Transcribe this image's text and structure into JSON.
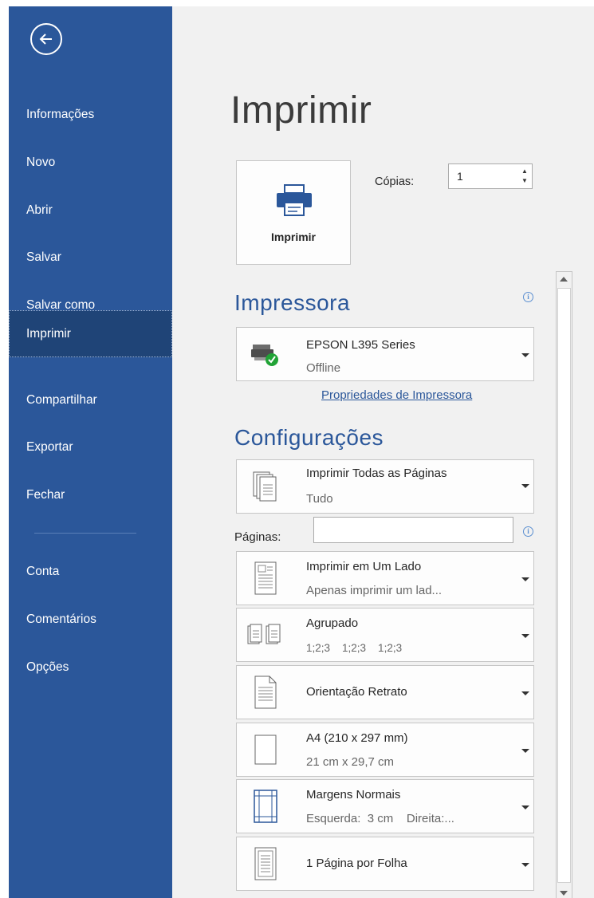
{
  "sidebar": {
    "items": [
      {
        "label": "Informações",
        "name": "sidebar-item-informacoes"
      },
      {
        "label": "Novo",
        "name": "sidebar-item-novo"
      },
      {
        "label": "Abrir",
        "name": "sidebar-item-abrir"
      },
      {
        "label": "Salvar",
        "name": "sidebar-item-salvar"
      },
      {
        "label": "Salvar como",
        "name": "sidebar-item-salvar-como"
      },
      {
        "label": "Imprimir",
        "name": "sidebar-item-imprimir",
        "active": true
      },
      {
        "label": "Compartilhar",
        "name": "sidebar-item-compartilhar"
      },
      {
        "label": "Exportar",
        "name": "sidebar-item-exportar"
      },
      {
        "label": "Fechar",
        "name": "sidebar-item-fechar"
      }
    ],
    "bottom_items": [
      {
        "label": "Conta",
        "name": "sidebar-item-conta"
      },
      {
        "label": "Comentários",
        "name": "sidebar-item-comentarios"
      },
      {
        "label": "Opções",
        "name": "sidebar-item-opcoes"
      }
    ]
  },
  "main": {
    "title": "Imprimir",
    "print_button_label": "Imprimir",
    "copies_label": "Cópias:",
    "copies_value": "1",
    "printer_section_title": "Impressora",
    "printer": {
      "name": "EPSON L395 Series",
      "status": "Offline"
    },
    "printer_properties_link": "Propriedades de Impressora",
    "settings_section_title": "Configurações",
    "pages_label": "Páginas:",
    "pages_value": "",
    "settings": [
      {
        "line1": "Imprimir Todas as Páginas",
        "line2": "Tudo"
      },
      {
        "line1": "Imprimir em Um Lado",
        "line2": "Apenas imprimir um lad..."
      },
      {
        "line1": "Agrupado",
        "line2": "1;2;3    1;2;3    1;2;3"
      },
      {
        "line1": "Orientação Retrato"
      },
      {
        "line1": "A4 (210 x 297 mm)",
        "line2": "21 cm x 29,7 cm"
      },
      {
        "line1": "Margens Normais",
        "line2": "Esquerda:  3 cm    Direita:..."
      },
      {
        "line1": "1 Página por Folha"
      }
    ]
  },
  "colors": {
    "sidebar_bg": "#2b579a",
    "sidebar_active": "#1f4477",
    "accent": "#2b579a",
    "content_bg": "#f1f1f1",
    "status_ok": "#21a336"
  },
  "icons": {
    "back": "back-arrow-icon",
    "printer": "printer-icon",
    "info": "info-icon",
    "dropdown": "chevron-down-icon"
  }
}
